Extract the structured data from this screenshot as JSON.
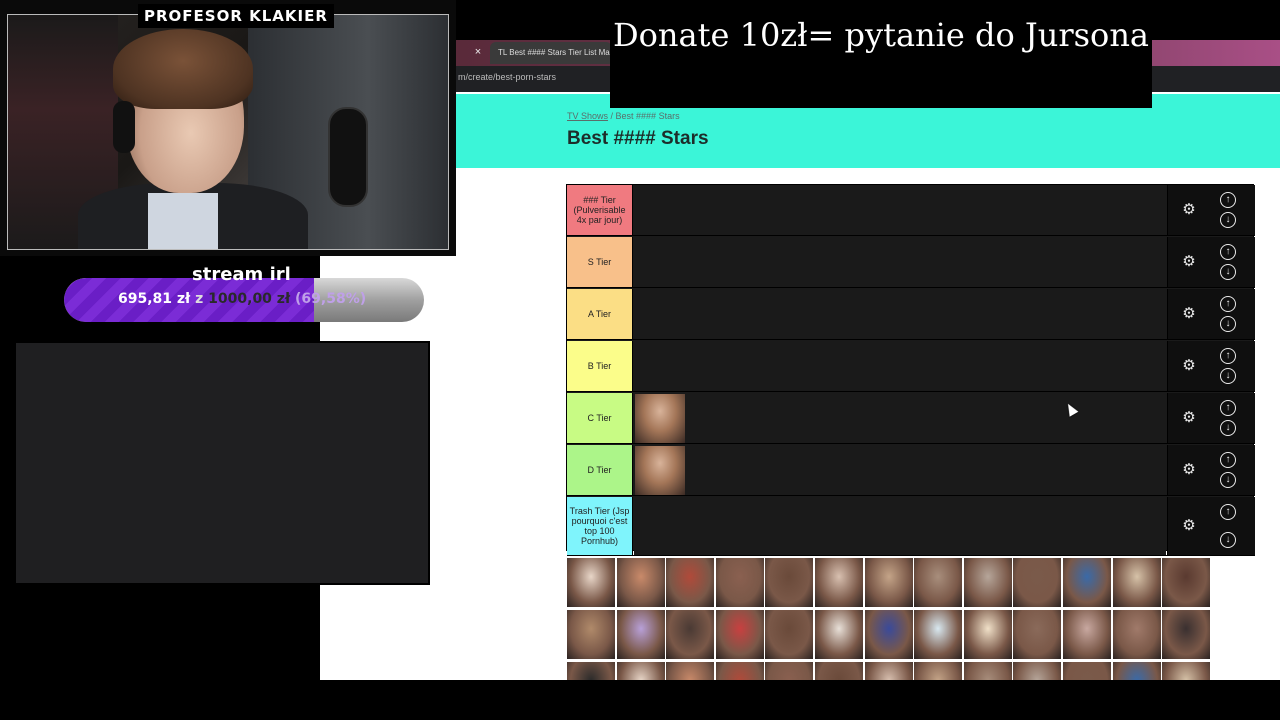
{
  "stream": {
    "streamer_name": "PROFESOR KLAKIER",
    "donation_title": "stream irl",
    "donation_current": "695,81 zł",
    "donation_separator": "z",
    "donation_goal": "1000,00 zł",
    "donation_percent": "(69,58%)",
    "donation_fraction": 0.6958,
    "donate_banner": "Donate 10zł= pytanie do Jursona"
  },
  "browser": {
    "tab_close": "×",
    "tab_title": "TL  Best #### Stars Tier List Make",
    "url": "m/create/best-porn-stars"
  },
  "page": {
    "breadcrumb_link": "TV Shows",
    "breadcrumb_sep": " / ",
    "breadcrumb_current": "Best #### Stars",
    "title": "Best #### Stars"
  },
  "tiers": [
    {
      "label": "### Tier (Pulverisable 4x par jour)",
      "color": "#f07a80",
      "items": 0
    },
    {
      "label": "S Tier",
      "color": "#f8c08a",
      "items": 0
    },
    {
      "label": "A Tier",
      "color": "#fbde85",
      "items": 0
    },
    {
      "label": "B Tier",
      "color": "#fbfd8a",
      "items": 0
    },
    {
      "label": "C Tier",
      "color": "#c8fb84",
      "items": 1
    },
    {
      "label": "D Tier",
      "color": "#acf589",
      "items": 1
    },
    {
      "label": "Trash Tier (Jsp pourquoi c'est top 100 Pornhub)",
      "color": "#7ff4fc",
      "items": 0
    }
  ],
  "icons": {
    "gear": "⚙",
    "up": "↑",
    "down": "↓"
  }
}
